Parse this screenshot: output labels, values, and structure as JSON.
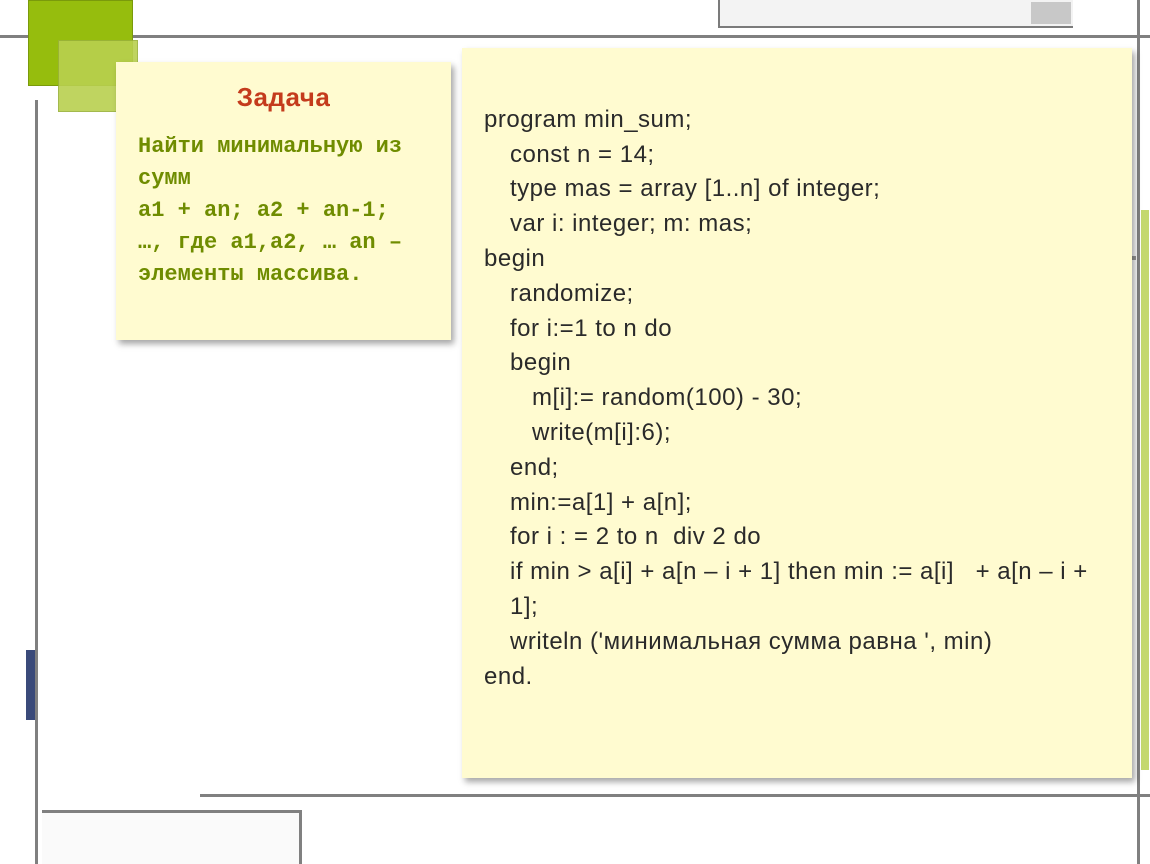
{
  "title": "Задача",
  "task": {
    "l1": "Найти минимальную из сумм",
    "l2": "a1 + an; a2 + an-1;",
    "l3": "…, где a1,a2, … an – элементы массива."
  },
  "code": {
    "c01": "program min_sum;",
    "c02": "const n = 14;",
    "c03": "type mas = array [1..n] of integer;",
    "c04": "var i: integer; m: mas;",
    "c05": "begin",
    "c06": "randomize;",
    "c07": "for i:=1 to n do",
    "c08": "begin",
    "c09": "m[i]:= random(100) - 30;",
    "c10": "write(m[i]:6);",
    "c11": "end;",
    "c12": "min:=a[1] + a[n];",
    "c13": "for i : = 2 to n  div 2 do",
    "c14": "if min > a[i] + a[n – i + 1] then min := a[i]   + a[n – i + 1];",
    "c15": "writeln ('минимальная сумма равна ', min)",
    "c16": "end."
  }
}
